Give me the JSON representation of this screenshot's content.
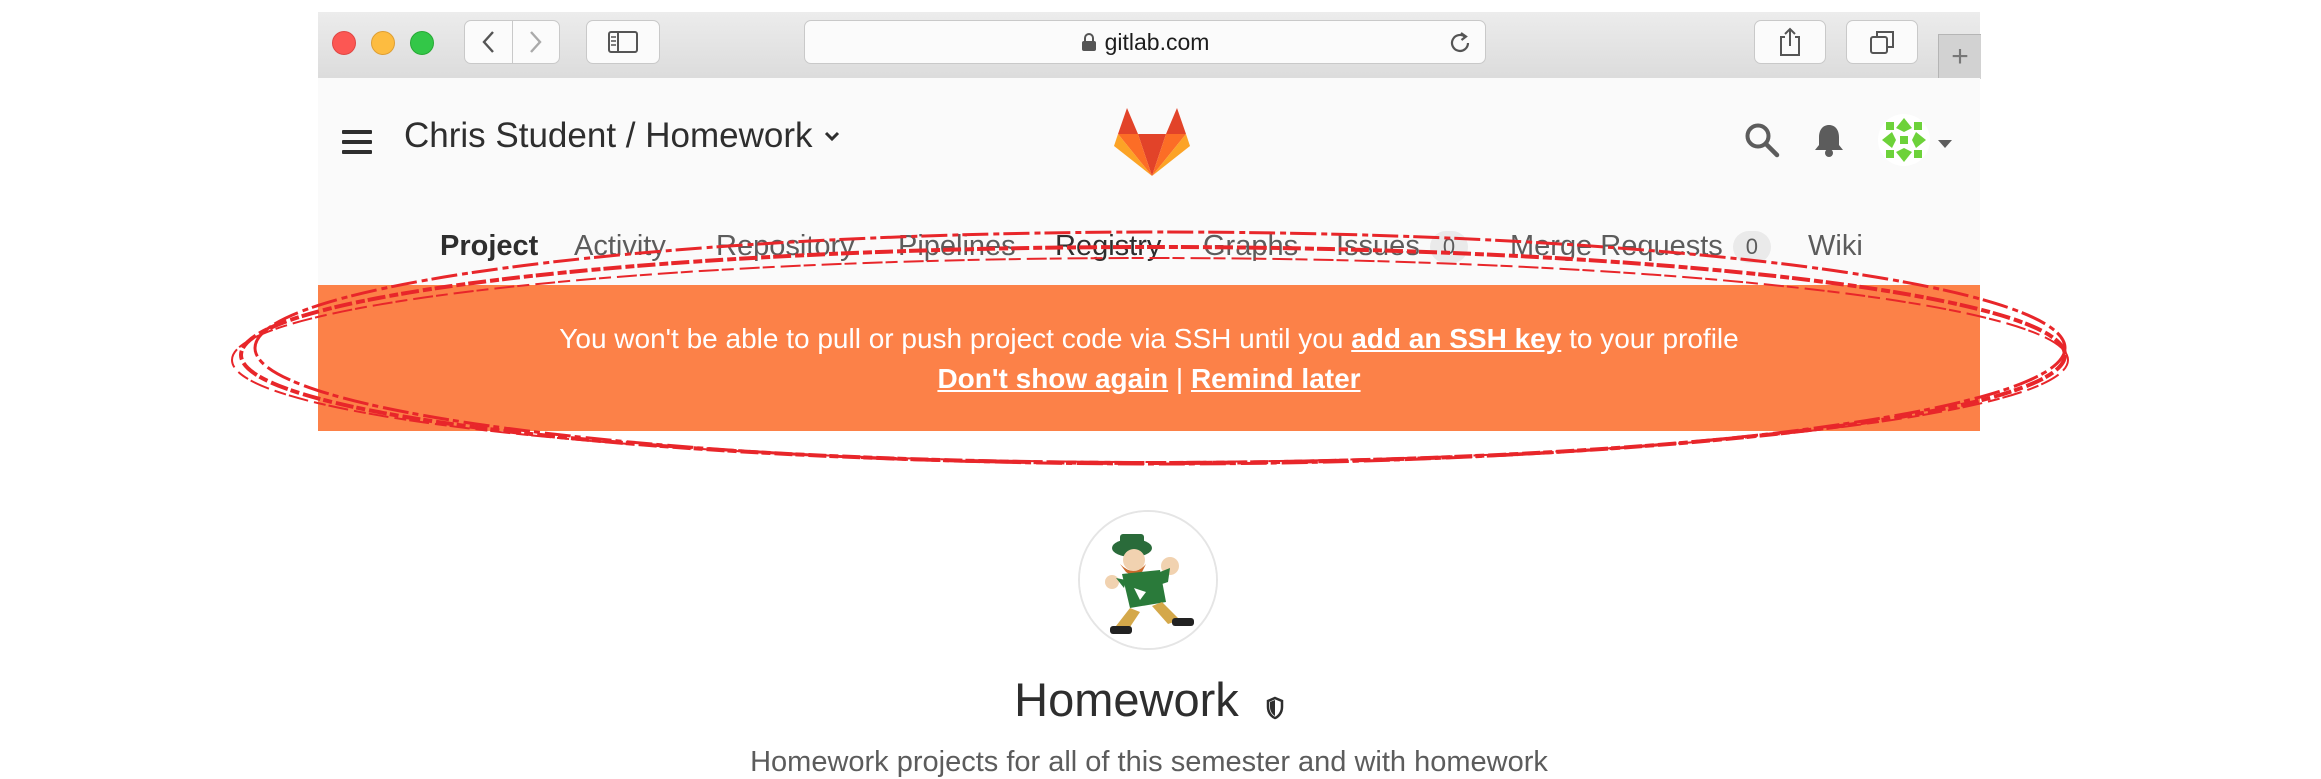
{
  "browser": {
    "url": "gitlab.com",
    "new_tab_symbol": "+"
  },
  "header": {
    "breadcrumb": "Chris Student / Homework",
    "icons": [
      "menu-icon",
      "gitlab-logo",
      "search-icon",
      "bell-icon",
      "avatar",
      "caret-down-icon"
    ]
  },
  "nav": {
    "items": [
      {
        "label": "Project",
        "active": true
      },
      {
        "label": "Activity"
      },
      {
        "label": "Repository"
      },
      {
        "label": "Pipelines"
      },
      {
        "label": "Registry"
      },
      {
        "label": "Graphs"
      },
      {
        "label": "Issues",
        "badge": "0"
      },
      {
        "label": "Merge Requests",
        "badge": "0"
      },
      {
        "label": "Wiki"
      }
    ]
  },
  "banner": {
    "text_before": "You won't be able to pull or push project code via SSH until you ",
    "link_add_ssh": "add an SSH key",
    "text_after": " to your profile",
    "link_dont_show": "Don't show again",
    "separator": " | ",
    "link_remind": "Remind later",
    "color": "#fc8148"
  },
  "project": {
    "name": "Homework",
    "description": "Homework projects for all of this semester and with homework"
  },
  "annotation": {
    "color": "#e8262a"
  }
}
